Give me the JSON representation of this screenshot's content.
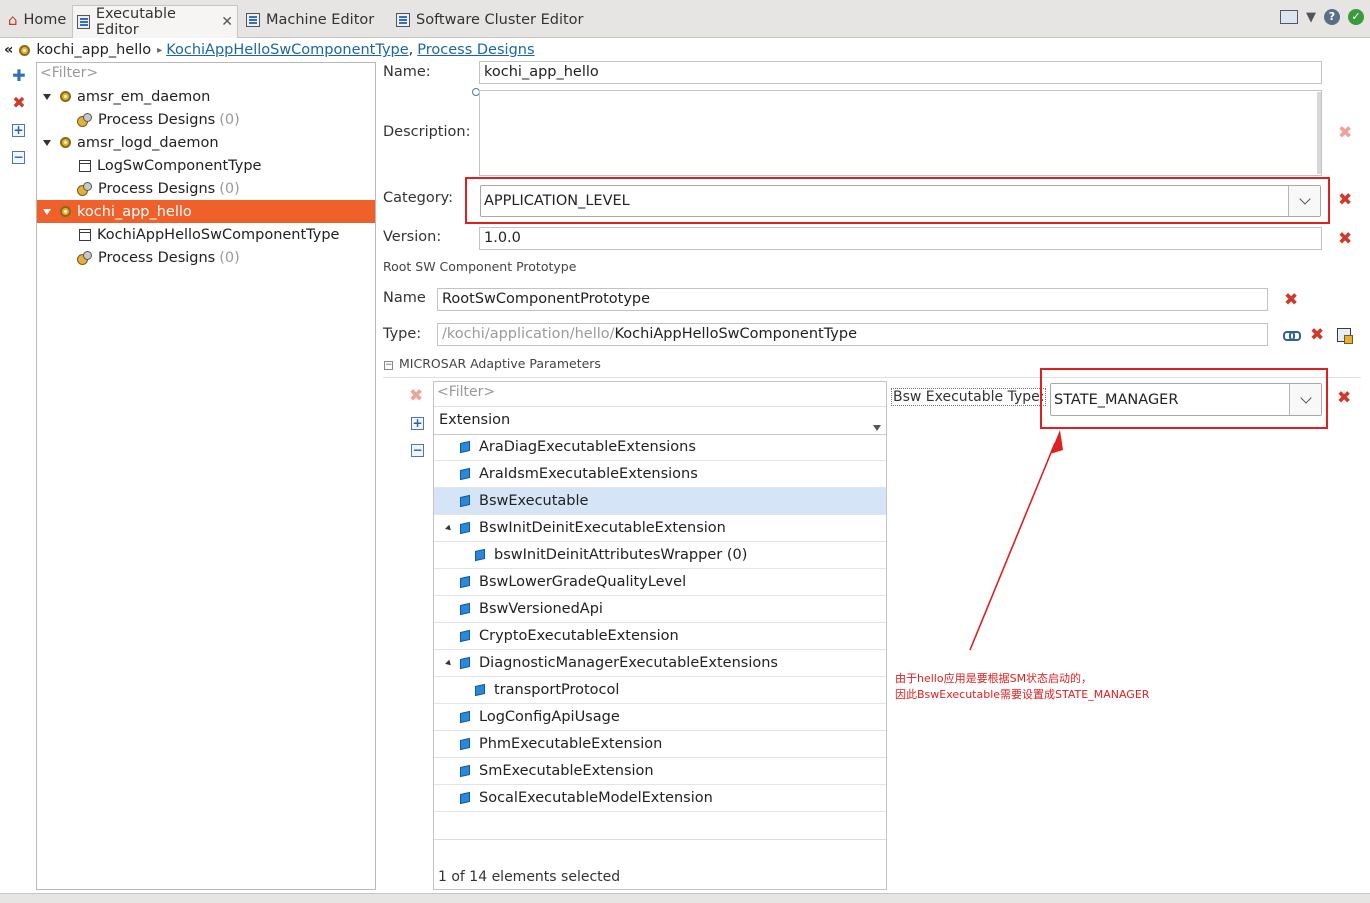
{
  "tabs": [
    {
      "label": "Home"
    },
    {
      "label": "Executable Editor"
    },
    {
      "label": "Machine Editor"
    },
    {
      "label": "Software Cluster Editor"
    }
  ],
  "breadcrumb": {
    "current": "kochi_app_hello",
    "link1": "KochiAppHelloSwComponentType",
    "separator": ",",
    "link2": "Process Designs"
  },
  "tree": {
    "filter_placeholder": "<Filter>",
    "items": [
      {
        "label": "amsr_em_daemon"
      },
      {
        "label": "Process Designs",
        "count": "(0)"
      },
      {
        "label": "amsr_logd_daemon"
      },
      {
        "label": "LogSwComponentType"
      },
      {
        "label": "Process Designs",
        "count": "(0)"
      },
      {
        "label": "kochi_app_hello"
      },
      {
        "label": "KochiAppHelloSwComponentType"
      },
      {
        "label": "Process Designs",
        "count": "(0)"
      }
    ]
  },
  "form": {
    "name_label": "Name:",
    "name_value": "kochi_app_hello",
    "description_label": "Description:",
    "description_value": "",
    "category_label": "Category:",
    "category_value": "APPLICATION_LEVEL",
    "version_label": "Version:",
    "version_value": "1.0.0",
    "root_section_title": "Root SW Component Prototype",
    "proto_name_label": "Name",
    "proto_name_value": "RootSwComponentPrototype",
    "type_label": "Type:",
    "type_prefix": "/kochi/application/hello/",
    "type_value": "KochiAppHelloSwComponentType",
    "microsar_section_title": "MICROSAR Adaptive Parameters",
    "bsw_type_label": "Bsw Executable Type:",
    "bsw_type_value": "STATE_MANAGER"
  },
  "extensions": {
    "filter_placeholder": "<Filter>",
    "column_header": "Extension",
    "rows": [
      {
        "label": "AraDiagExecutableExtensions"
      },
      {
        "label": "AraIdsmExecutableExtensions"
      },
      {
        "label": "BswExecutable"
      },
      {
        "label": "BswInitDeinitExecutableExtension"
      },
      {
        "label": "bswInitDeinitAttributesWrapper (0)"
      },
      {
        "label": "BswLowerGradeQualityLevel"
      },
      {
        "label": "BswVersionedApi"
      },
      {
        "label": "CryptoExecutableExtension"
      },
      {
        "label": "DiagnosticManagerExecutableExtensions"
      },
      {
        "label": "transportProtocol"
      },
      {
        "label": "LogConfigApiUsage"
      },
      {
        "label": "PhmExecutableExtension"
      },
      {
        "label": "SmExecutableExtension"
      },
      {
        "label": "SocalExecutableModelExtension"
      }
    ],
    "status": "1 of 14 elements selected"
  },
  "annotation": {
    "line1": "由于hello应用是要根据SM状态启动的，",
    "line2": "因此BswExecutable需要设置成STATE_MANAGER"
  },
  "colors": {
    "selection_orange": "#f0602b",
    "annotation_red": "#e02020",
    "list_selection_blue": "#d5e4f7"
  }
}
